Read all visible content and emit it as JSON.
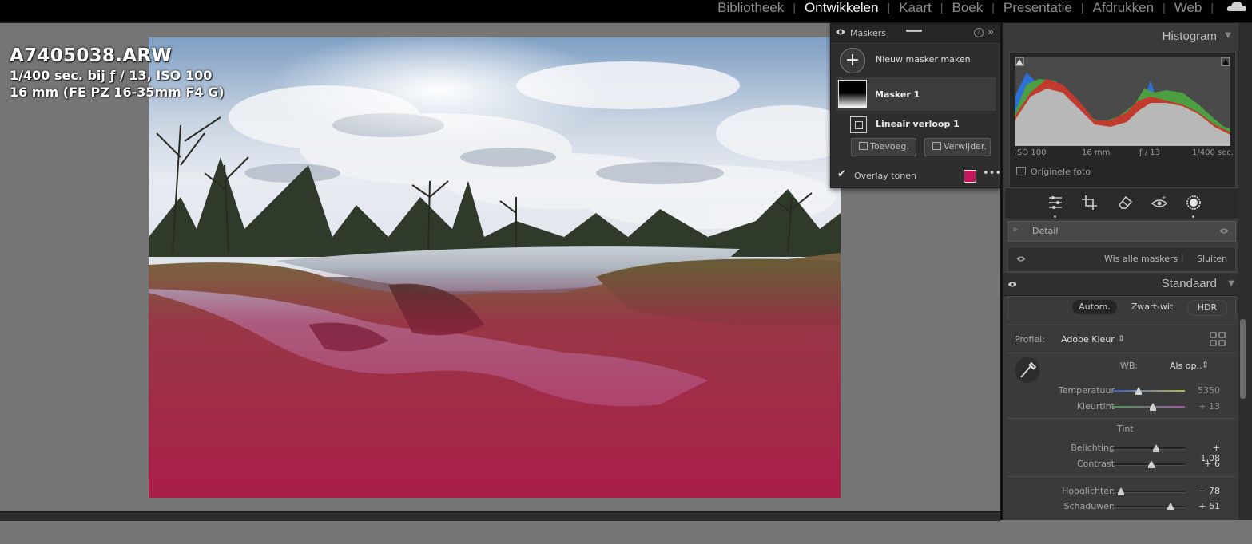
{
  "modules": [
    "Bibliotheek",
    "Ontwikkelen",
    "Kaart",
    "Boek",
    "Presentatie",
    "Afdrukken",
    "Web"
  ],
  "active_module": "Ontwikkelen",
  "photo_info": {
    "filename": "A7405038.ARW",
    "exposure": "1/400 sec. bij ƒ / 13, ISO 100",
    "lens": "16 mm (FE PZ 16-35mm F4 G)"
  },
  "masks_panel": {
    "title": "Maskers",
    "help": "?",
    "collapse": "»",
    "new_mask_label": "Nieuw masker maken",
    "mask_name": "Masker 1",
    "component_name": "Lineair verloop 1",
    "add_label": "Toevoeg.",
    "remove_label": "Verwijder.",
    "overlay_label": "Overlay tonen",
    "overlay_checked": true,
    "overlay_color": "#c2185b",
    "more": "•••"
  },
  "histogram": {
    "title": "Histogram",
    "iso": "ISO 100",
    "focal": "16 mm",
    "aperture": "ƒ / 13",
    "shutter": "1/400 sec.",
    "original_photo_label": "Originele foto"
  },
  "tools": [
    "sliders-icon",
    "crop-icon",
    "eraser-icon",
    "redeye-icon",
    "mask-icon"
  ],
  "detail_label": "Detail",
  "masks_actions": {
    "clear_all": "Wis alle maskers",
    "close": "Sluiten"
  },
  "standard": {
    "title": "Standaard",
    "modes": [
      "Autom.",
      "Zwart-wit",
      "HDR"
    ],
    "profile_label": "Profiel:",
    "profile_value": "Adobe Kleur",
    "wb_label": "WB:",
    "wb_value": "Als op..",
    "tint_section": "Tint"
  },
  "sliders": [
    {
      "label": "Temperatuur",
      "value": "5350",
      "pos": 0.35,
      "dim": true
    },
    {
      "label": "Kleurtint",
      "value": "+ 13",
      "pos": 0.55,
      "dim": true
    },
    {
      "label": "Belichting",
      "value": "+ 1,08",
      "pos": 0.6,
      "dim": false
    },
    {
      "label": "Contrast",
      "value": "+ 6",
      "pos": 0.53,
      "dim": false
    },
    {
      "label": "Hooglichten",
      "value": "− 78",
      "pos": 0.11,
      "dim": false
    },
    {
      "label": "Schaduwen",
      "value": "+ 61",
      "pos": 0.8,
      "dim": false
    }
  ]
}
